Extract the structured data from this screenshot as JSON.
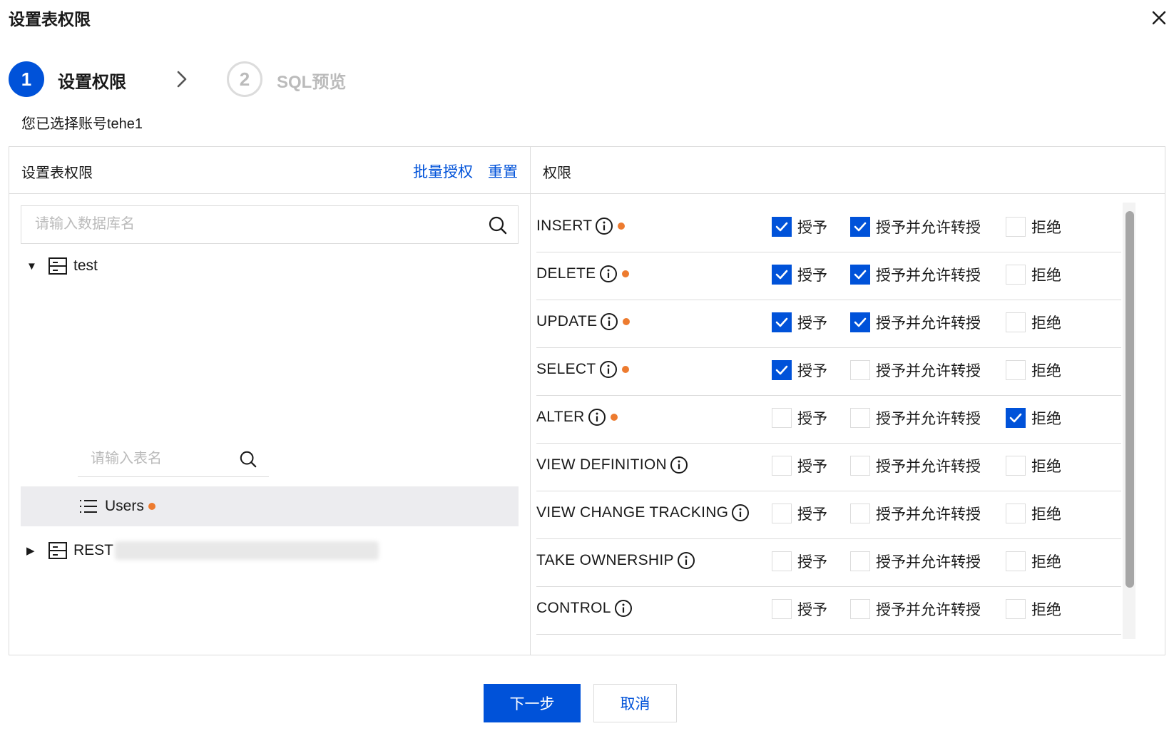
{
  "dialog": {
    "title": "设置表权限",
    "close_icon": "close-icon"
  },
  "steps": [
    {
      "number": "1",
      "label": "设置权限",
      "state": "active"
    },
    {
      "number": "2",
      "label": "SQL预览",
      "state": "inactive"
    }
  ],
  "account_text": "您已选择账号tehe1",
  "left_panel": {
    "title": "设置表权限",
    "batch_link": "批量授权",
    "reset_link": "重置",
    "db_search_placeholder": "请输入数据库名",
    "table_search_placeholder": "请输入表名",
    "tree": {
      "db1": "test",
      "table1": "Users",
      "db2": "REST"
    }
  },
  "right_panel": {
    "title": "权限",
    "option_labels": {
      "grant": "授予",
      "grant_with": "授予并允许转授",
      "deny": "拒绝"
    },
    "permissions": [
      {
        "name": "INSERT",
        "dot": true,
        "grant": true,
        "grant_with": true,
        "deny": false
      },
      {
        "name": "DELETE",
        "dot": true,
        "grant": true,
        "grant_with": true,
        "deny": false
      },
      {
        "name": "UPDATE",
        "dot": true,
        "grant": true,
        "grant_with": true,
        "deny": false
      },
      {
        "name": "SELECT",
        "dot": true,
        "grant": true,
        "grant_with": false,
        "deny": false
      },
      {
        "name": "ALTER",
        "dot": true,
        "grant": false,
        "grant_with": false,
        "deny": true
      },
      {
        "name": "VIEW DEFINITION",
        "dot": false,
        "grant": false,
        "grant_with": false,
        "deny": false
      },
      {
        "name": "VIEW CHANGE TRACKING",
        "dot": false,
        "grant": false,
        "grant_with": false,
        "deny": false
      },
      {
        "name": "TAKE OWNERSHIP",
        "dot": false,
        "grant": false,
        "grant_with": false,
        "deny": false
      },
      {
        "name": "CONTROL",
        "dot": false,
        "grant": false,
        "grant_with": false,
        "deny": false
      }
    ]
  },
  "footer": {
    "next_label": "下一步",
    "cancel_label": "取消"
  },
  "colors": {
    "primary": "#0052d9",
    "modified_dot": "#ed7b2f",
    "border": "#dcdcdc"
  }
}
